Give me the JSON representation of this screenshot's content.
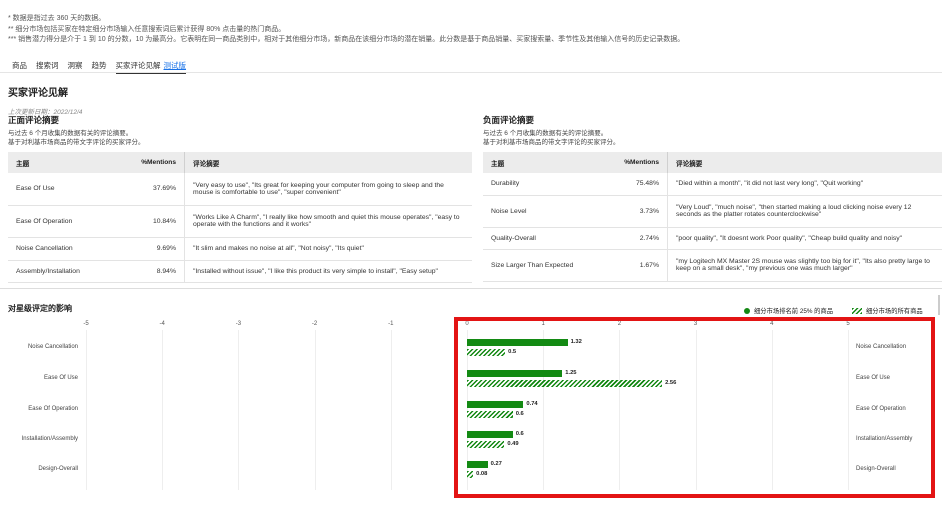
{
  "notes": [
    "* 数据是指过去 360 天的数据。",
    "** 细分市场包括买家在特定细分市场输入任意搜索词后累计获得 80% 点击量的热门商品。",
    "*** 销售潜力得分是介于 1 到 10 的分数，10 为最高分。它表明在同一商品类别中，相对于其他细分市场，新商品在该细分市场的潜在销量。此分数是基于商品销量、买家搜索量、季节性及其他输入信号的历史记录数据。"
  ],
  "tabs": [
    {
      "label": "商品"
    },
    {
      "label": "搜索词"
    },
    {
      "label": "洞察"
    },
    {
      "label": "趋势"
    },
    {
      "label": "买家评论见解",
      "badge": "测试版",
      "active": true
    }
  ],
  "section_title": "买家评论见解",
  "updated": "上次更新日期：2022/12/4",
  "positive": {
    "title": "正面评论摘要",
    "desc1": "与过去 6 个月收集的数据有关的评论摘要。",
    "desc2": "基于对利基市场商品的带文字评论的买家评分。",
    "headers": [
      "主题",
      "%Mentions",
      "评论摘要"
    ],
    "rows": [
      {
        "topic": "Ease Of Use",
        "pct": "37.69%",
        "summary": "\"Very easy to use\", \"Its great for keeping your computer from going to sleep and the mouse is comfortable to use\", \"super convenient\""
      },
      {
        "topic": "Ease Of Operation",
        "pct": "10.84%",
        "summary": "\"Works Like A Charm\", \"I really like how smooth and quiet this mouse operates\", \"easy to operate with the functions and it works\""
      },
      {
        "topic": "Noise Cancellation",
        "pct": "9.69%",
        "summary": "\"It slim and makes no noise at all\", \"Not noisy\", \"Its quiet\""
      },
      {
        "topic": "Assembly/Installation",
        "pct": "8.94%",
        "summary": "\"Installed without issue\", \"I like this product its very simple to install\", \"Easy setup\""
      }
    ]
  },
  "negative": {
    "title": "负面评论摘要",
    "desc1": "与过去 6 个月收集的数据有关的评论摘要。",
    "desc2": "基于对利基市场商品的带文字评论的买家评分。",
    "headers": [
      "主题",
      "%Mentions",
      "评论摘要"
    ],
    "rows": [
      {
        "topic": "Durability",
        "pct": "75.48%",
        "summary": "\"Died within a month\", \"it did not last very long\", \"Quit working\""
      },
      {
        "topic": "Noise Level",
        "pct": "3.73%",
        "summary": "\"Very Loud\", \"much noise\", \"then started making a loud clicking noise every 12 seconds as the platter rotates counterclockwise\""
      },
      {
        "topic": "Quality-Overall",
        "pct": "2.74%",
        "summary": "\"poor quality\", \"It doesnt work Poor quality\", \"Cheap build quality and noisy\""
      },
      {
        "topic": "Size Larger Than Expected",
        "pct": "1.67%",
        "summary": "\"my Logitech MX Master 2S mouse was slightly too big for it\", \"Its also pretty large to keep on a small desk\", \"my previous one was much larger\""
      }
    ]
  },
  "impact": {
    "title": "对星级评定的影响",
    "legend_top": "细分市场排名前 25% 的商品",
    "legend_all": "细分市场的所有商品"
  },
  "chart_data": {
    "type": "bar",
    "orientation": "horizontal",
    "categories": [
      "Noise Cancellation",
      "Ease Of Use",
      "Ease Of Operation",
      "Installation/Assembly",
      "Design-Overall"
    ],
    "series": [
      {
        "name": "细分市场排名前 25% 的商品",
        "values": [
          1.32,
          1.25,
          0.74,
          0.6,
          0.27
        ],
        "color": "#138a13"
      },
      {
        "name": "细分市场的所有商品",
        "values": [
          0.5,
          2.56,
          0.6,
          0.49,
          0.08
        ],
        "color": "#128812",
        "pattern": "hatch"
      }
    ],
    "xlim": [
      -5,
      5
    ],
    "ticks": [
      "-5",
      "-4",
      "-3",
      "-2",
      "-1",
      "0",
      "1",
      "2",
      "3",
      "4",
      "5"
    ],
    "highlight_color": "#e31414"
  }
}
